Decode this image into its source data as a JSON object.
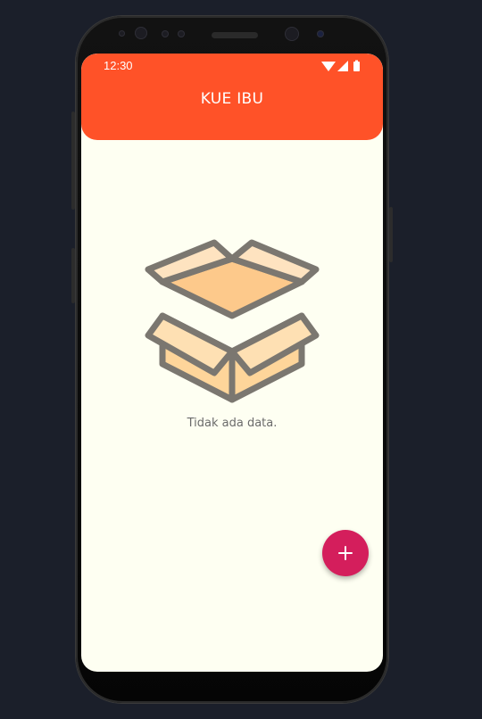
{
  "status_bar": {
    "time": "12:30",
    "icons": [
      "wifi-icon",
      "signal-icon",
      "battery-icon"
    ]
  },
  "app_bar": {
    "title": "KUE IBU",
    "color": "#ff5228"
  },
  "empty_state": {
    "icon": "empty-box-icon",
    "message": "Tidak ada data."
  },
  "fab": {
    "icon": "plus-icon",
    "color": "#d41e5c"
  },
  "colors": {
    "background": "#fefff2",
    "page_backdrop": "#1b1f2a"
  }
}
